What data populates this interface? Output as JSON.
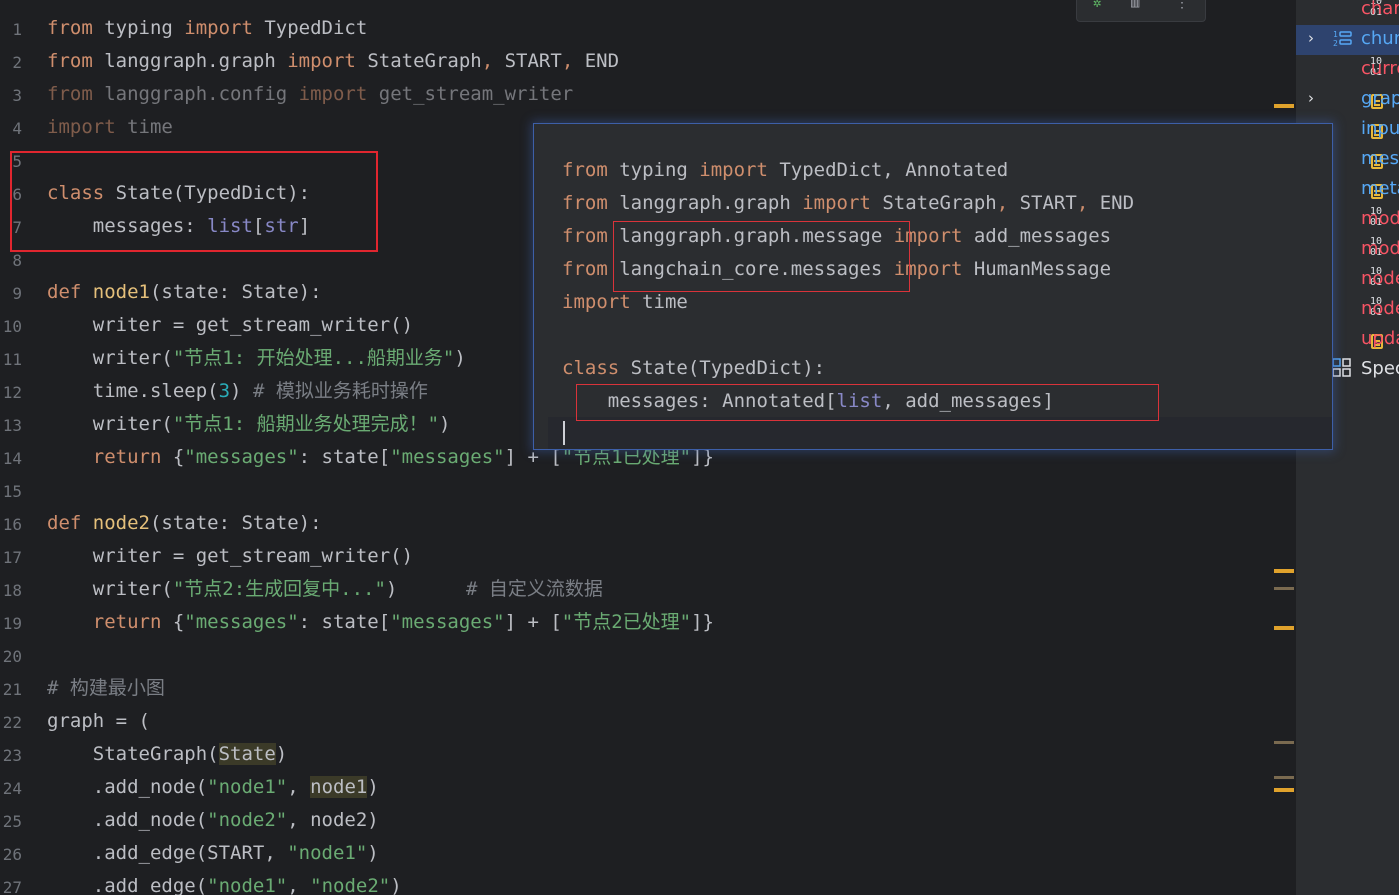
{
  "editor": {
    "line_numbers": [
      "1",
      "2",
      "3",
      "4",
      "5",
      "6",
      "7",
      "8",
      "9",
      "10",
      "11",
      "12",
      "13",
      "14",
      "15",
      "16",
      "17",
      "18",
      "19",
      "20",
      "21",
      "22",
      "23",
      "24",
      "25",
      "26",
      "27"
    ],
    "code": {
      "l1": {
        "k1": "from",
        "t1": " typing ",
        "k2": "import",
        "t2": " TypedDict"
      },
      "l2": {
        "k1": "from",
        "t1": " langgraph.graph ",
        "k2": "import",
        "t2": " StateGraph",
        "p1": ",",
        "t3": " START",
        "p2": ",",
        "t4": " END"
      },
      "l3": {
        "k1": "from",
        "t1": " langgraph.config ",
        "k2": "import",
        "t2": " get_stream_writer"
      },
      "l4": {
        "k1": "import",
        "t1": " time"
      },
      "l6": {
        "k1": "class",
        "t1": " State(TypedDict):"
      },
      "l7": {
        "t1": "    messages: ",
        "b1": "list",
        "t2": "[",
        "b2": "str",
        "t3": "]"
      },
      "l9": {
        "k1": "def",
        "f1": " node1",
        "t1": "(state: State):"
      },
      "l10": {
        "t1": "    writer = get_stream_writer()"
      },
      "l11": {
        "t1": "    writer(",
        "s1": "\"节点1: 开始处理...船期业务\"",
        "t2": ")"
      },
      "l12": {
        "t1": "    time.sleep(",
        "n1": "3",
        "t2": ") ",
        "c1": "# 模拟业务耗时操作"
      },
      "l13": {
        "t1": "    writer(",
        "s1": "\"节点1: 船期业务处理完成！\"",
        "t2": ")"
      },
      "l14": {
        "k1": "    return",
        "t1": " {",
        "s1": "\"messages\"",
        "t2": ": state[",
        "s2": "\"messages\"",
        "t3": "] + [",
        "s3": "\"节点1已处理\"",
        "t4": "]}"
      },
      "l16": {
        "k1": "def",
        "f1": " node2",
        "t1": "(state: State):"
      },
      "l17": {
        "t1": "    writer = get_stream_writer()"
      },
      "l18": {
        "t1": "    writer(",
        "s1": "\"节点2:生成回复中...\"",
        "t2": ")      ",
        "c1": "# 自定义流数据"
      },
      "l19": {
        "k1": "    return",
        "t1": " {",
        "s1": "\"messages\"",
        "t2": ": state[",
        "s2": "\"messages\"",
        "t3": "] + [",
        "s3": "\"节点2已处理\"",
        "t4": "]}"
      },
      "l21": {
        "c1": "# 构建最小图"
      },
      "l22": {
        "t1": "graph = ("
      },
      "l23": {
        "t1": "    StateGraph(",
        "h1": "State",
        "t2": ")"
      },
      "l24": {
        "t1": "    .add_node(",
        "s1": "\"node1\"",
        "t2": ", ",
        "h1": "node1",
        "t3": ")"
      },
      "l25": {
        "t1": "    .add_node(",
        "s1": "\"node2\"",
        "t2": ", node2)"
      },
      "l26": {
        "t1": "    .add_edge(START, ",
        "s1": "\"node1\"",
        "t2": ")"
      },
      "l27": {
        "t1": "    .add_edge(",
        "s1": "\"node1\"",
        "t2": ", ",
        "s2": "\"node2\"",
        "t3": ")"
      }
    }
  },
  "popup": {
    "p1": {
      "k1": "from",
      "t1": " typing ",
      "k2": "import",
      "t2": " TypedDict, Annotated"
    },
    "p2": {
      "k1": "from",
      "t1": " langgraph.graph ",
      "k2": "import",
      "t2": " StateGraph",
      "p1": ",",
      "t3": " START",
      "p2": ",",
      "t4": " END"
    },
    "p3": {
      "k1": "from",
      "t1": " langgraph.graph.message ",
      "k2": "import",
      "t2": " add_messages"
    },
    "p4": {
      "k1": "from",
      "t1": " langchain_core.messages ",
      "k2": "import",
      "t2": " HumanMessage"
    },
    "p5": {
      "k1": "import",
      "t1": " time"
    },
    "p7": {
      "k1": "class",
      "t1": " State(TypedDict):"
    },
    "p8": {
      "t1": "    messages: Annotated[",
      "b1": "list",
      "t2": ", add_messages]"
    }
  },
  "structure": {
    "items": [
      {
        "label": "char",
        "icon": "binary-icon",
        "color": "#f75464"
      },
      {
        "label": "chun",
        "icon": "list-icon",
        "color": "#56a8f5"
      },
      {
        "label": "curre",
        "icon": "binary-icon",
        "color": "#f75464"
      },
      {
        "label": "grap",
        "icon": "field-icon",
        "color": "#56a8f5"
      },
      {
        "label": "inpu",
        "icon": "field-icon",
        "color": "#56a8f5"
      },
      {
        "label": "mess",
        "icon": "field-icon",
        "color": "#56a8f5"
      },
      {
        "label": "meta",
        "icon": "field-icon",
        "color": "#56a8f5"
      },
      {
        "label": "mod",
        "icon": "binary-icon",
        "color": "#f75464"
      },
      {
        "label": "mod",
        "icon": "binary-icon",
        "color": "#f75464"
      },
      {
        "label": "node",
        "icon": "binary-icon",
        "color": "#f75464"
      },
      {
        "label": "node",
        "icon": "binary-icon",
        "color": "#f75464"
      },
      {
        "label": "upda",
        "icon": "field-icon",
        "color": "#f75464"
      },
      {
        "label": "Spec",
        "icon": "grid-icon",
        "color": "#dfe1e5"
      }
    ]
  },
  "colors": {
    "keyword": "#cf8e6d",
    "string": "#6aab73",
    "function": "#56a8f5",
    "highlight_box": "#e0262f",
    "popup_border": "#3d5fa8"
  }
}
